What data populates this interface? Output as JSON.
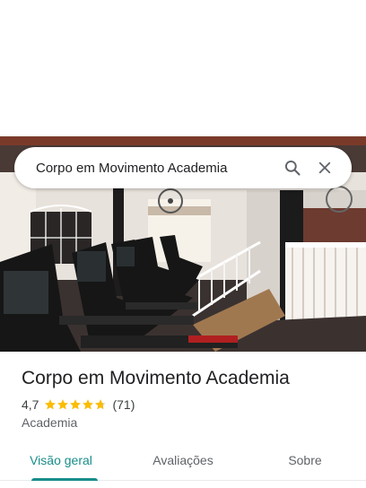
{
  "search": {
    "query": "Corpo em Movimento Academia"
  },
  "icons": {
    "search": "search-icon",
    "close": "close-icon",
    "star": "star-icon"
  },
  "place": {
    "name": "Corpo em Movimento Academia",
    "rating": "4,7",
    "rating_value": 4.7,
    "reviews": "(71)",
    "category": "Academia"
  },
  "photo": {
    "description_icon": "gym-photo"
  },
  "tabs": [
    {
      "label": "Visão geral",
      "active": true
    },
    {
      "label": "Avaliações",
      "active": false
    },
    {
      "label": "Sobre",
      "active": false
    }
  ],
  "colors": {
    "accent": "#188d8a",
    "star": "#fbbc04",
    "star_empty": "#dadce0"
  }
}
